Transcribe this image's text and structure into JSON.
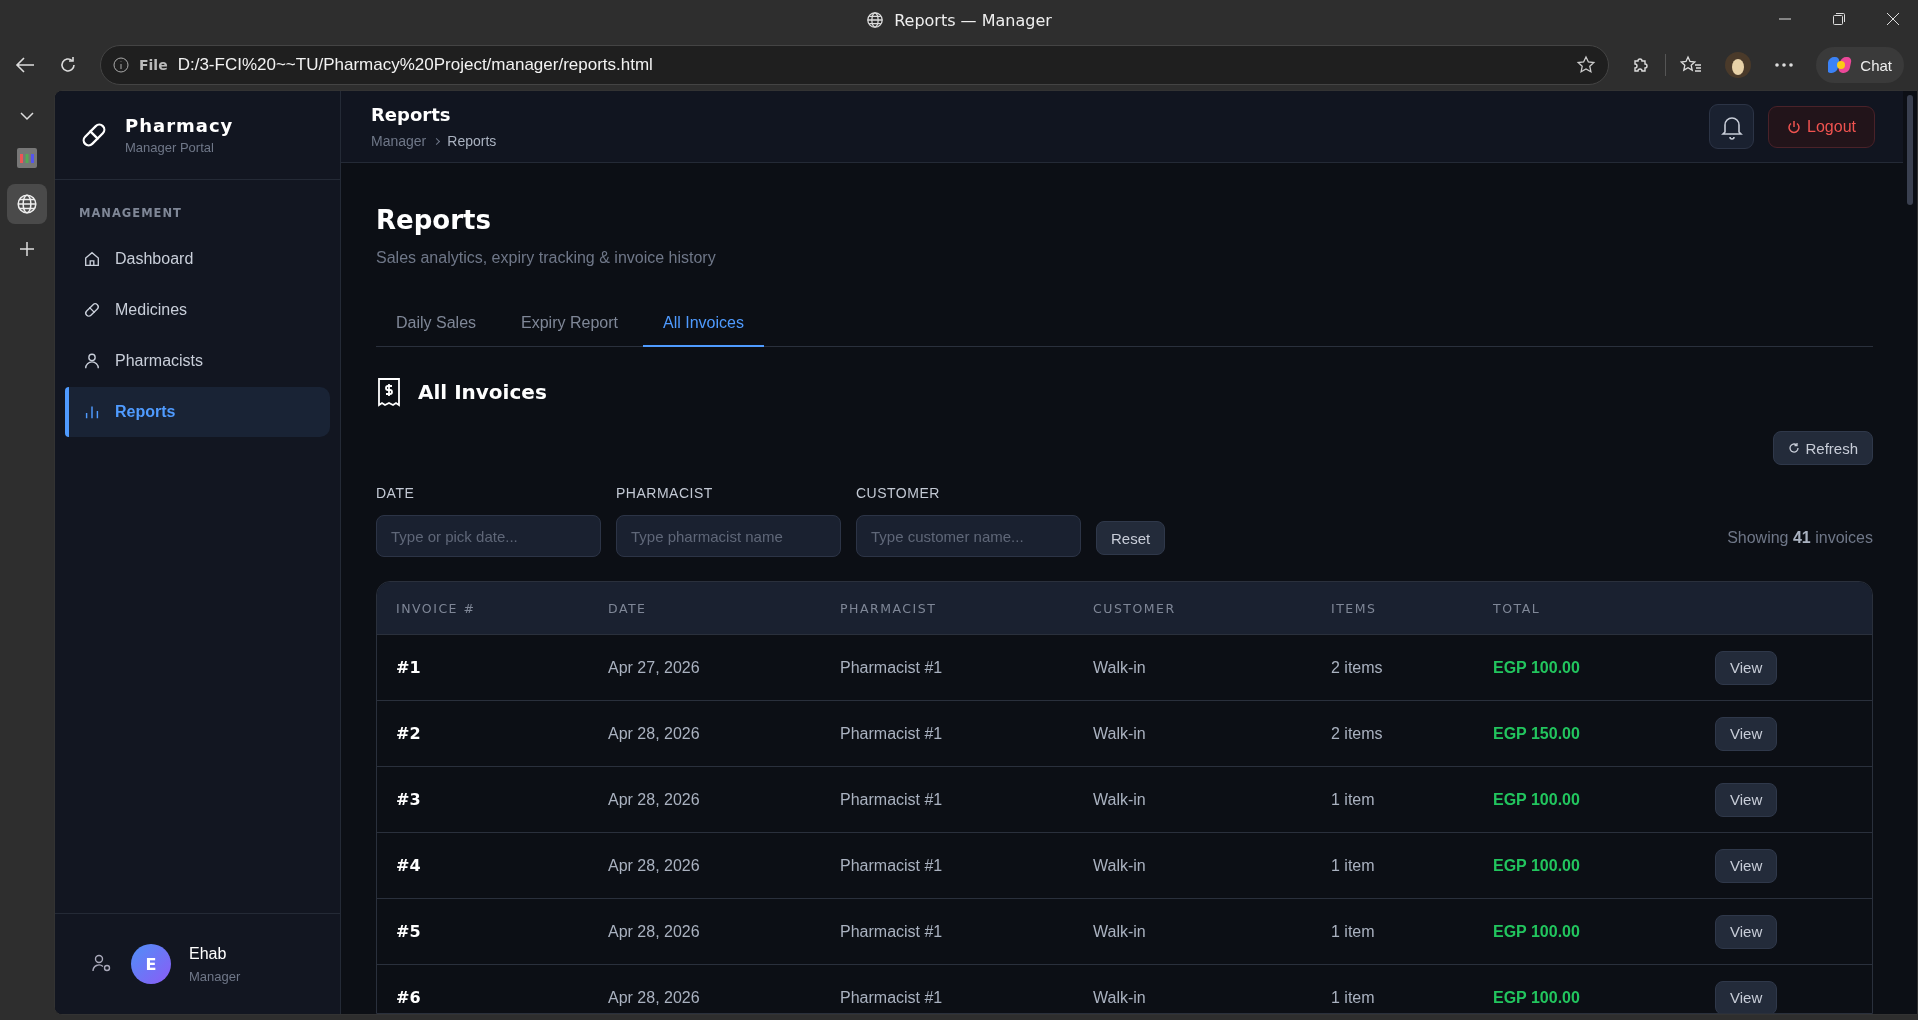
{
  "browser": {
    "title": "Reports — Manager",
    "url_label": "File",
    "url": "D:/3-FCI%20~~TU/Pharmacy%20Project/manager/reports.html",
    "chat": "Chat"
  },
  "sidebar": {
    "brand": "Pharmacy",
    "subtitle": "Manager Portal",
    "section": "MANAGEMENT",
    "items": [
      {
        "label": "Dashboard",
        "selected": false
      },
      {
        "label": "Medicines",
        "selected": false
      },
      {
        "label": "Pharmacists",
        "selected": false
      },
      {
        "label": "Reports",
        "selected": true
      }
    ],
    "user": {
      "initial": "E",
      "name": "Ehab",
      "role": "Manager"
    }
  },
  "header": {
    "title": "Reports",
    "breadcrumb": [
      "Manager",
      "Reports"
    ],
    "logout": "Logout"
  },
  "page": {
    "title": "Reports",
    "subtitle": "Sales analytics, expiry tracking & invoice history",
    "tabs": [
      {
        "label": "Daily Sales",
        "selected": false
      },
      {
        "label": "Expiry Report",
        "selected": false
      },
      {
        "label": "All Invoices",
        "selected": true
      }
    ],
    "section_title": "All Invoices",
    "refresh": "Refresh",
    "filters": [
      {
        "label": "DATE",
        "placeholder": "Type or pick date..."
      },
      {
        "label": "PHARMACIST",
        "placeholder": "Type pharmacist name"
      },
      {
        "label": "CUSTOMER",
        "placeholder": "Type customer name..."
      }
    ],
    "reset": "Reset",
    "showing": "Showing **41** invoices"
  },
  "table": {
    "columns": [
      "INVOICE #",
      "DATE",
      "PHARMACIST",
      "CUSTOMER",
      "ITEMS",
      "TOTAL"
    ],
    "rows": [
      {
        "invoice": "#1",
        "date": "Apr 27, 2026",
        "pharmacist": "Pharmacist #1",
        "customer": "Walk-in",
        "items": "2 items",
        "total": "EGP 100.00",
        "action": "View"
      },
      {
        "invoice": "#2",
        "date": "Apr 28, 2026",
        "pharmacist": "Pharmacist #1",
        "customer": "Walk-in",
        "items": "2 items",
        "total": "EGP 150.00",
        "action": "View"
      },
      {
        "invoice": "#3",
        "date": "Apr 28, 2026",
        "pharmacist": "Pharmacist #1",
        "customer": "Walk-in",
        "items": "1 item",
        "total": "EGP 100.00",
        "action": "View"
      },
      {
        "invoice": "#4",
        "date": "Apr 28, 2026",
        "pharmacist": "Pharmacist #1",
        "customer": "Walk-in",
        "items": "1 item",
        "total": "EGP 100.00",
        "action": "View"
      },
      {
        "invoice": "#5",
        "date": "Apr 28, 2026",
        "pharmacist": "Pharmacist #1",
        "customer": "Walk-in",
        "items": "1 item",
        "total": "EGP 100.00",
        "action": "View"
      },
      {
        "invoice": "#6",
        "date": "Apr 28, 2026",
        "pharmacist": "Pharmacist #1",
        "customer": "Walk-in",
        "items": "1 item",
        "total": "EGP 100.00",
        "action": "View"
      }
    ]
  }
}
